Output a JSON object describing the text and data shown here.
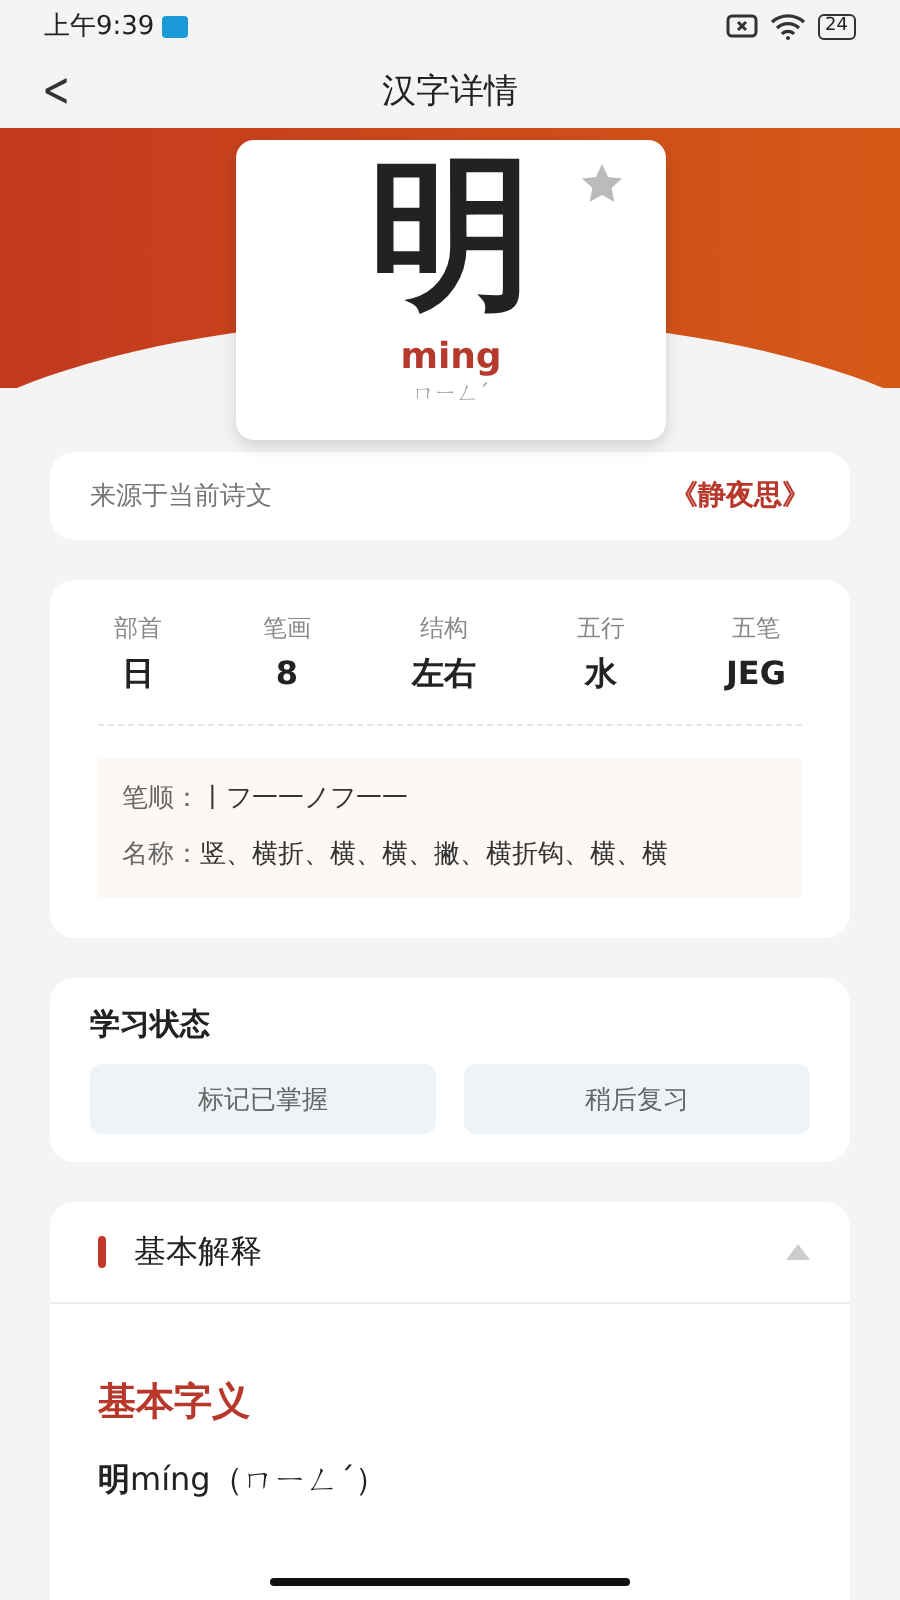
{
  "status_bar": {
    "time": "上午9:39",
    "battery": "24"
  },
  "nav": {
    "back": "<",
    "title": "汉字详情"
  },
  "character": {
    "glyph": "明",
    "pinyin": "ming",
    "zhuyin": "ㄇㄧㄥˊ",
    "favorite": false
  },
  "source": {
    "label": "来源于当前诗文",
    "poem": "《静夜思》"
  },
  "attributes": [
    {
      "label": "部首",
      "value": "日"
    },
    {
      "label": "笔画",
      "value": "8"
    },
    {
      "label": "结构",
      "value": "左右"
    },
    {
      "label": "五行",
      "value": "水"
    },
    {
      "label": "五笔",
      "value": "JEG"
    }
  ],
  "strokes": [
    {
      "label": "笔顺：",
      "value": "丨フ一一ノフ一一"
    },
    {
      "label": "名称：",
      "value": "竖、横折、横、横、撇、横折钩、横、横"
    }
  ],
  "study": {
    "title": "学习状态",
    "buttons": [
      "标记已掌握",
      "稍后复习"
    ]
  },
  "explanation": {
    "title": "基本解释",
    "expanded": true,
    "subtitle": "基本字义",
    "entry": "**明**míng（ㄇㄧㄥˊ）"
  }
}
